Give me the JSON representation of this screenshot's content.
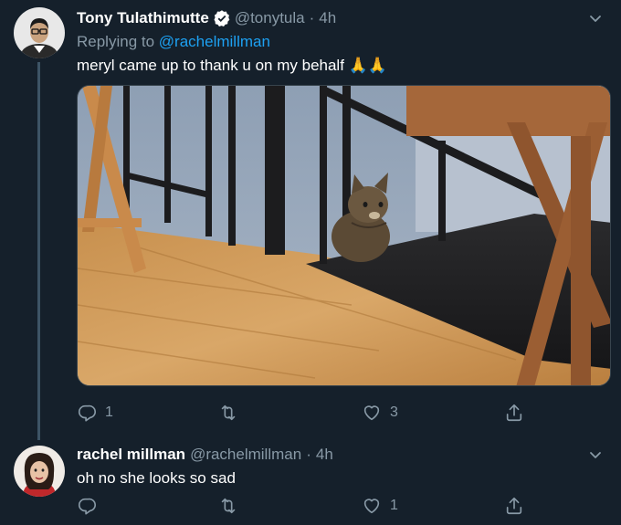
{
  "tweet_main": {
    "author_name": "Tony Tulathimutte",
    "handle": "@tonytula",
    "separator": "·",
    "time": "4h",
    "replying_prefix": "Replying to",
    "replying_handle": "@rachelmillman",
    "text": "meryl came up to thank u on my behalf 🙏🙏",
    "media_description": "photo of a tabby cat peeking over stair railing on a wooden floor",
    "reply_count": "1",
    "retweet_count": "",
    "like_count": "3"
  },
  "tweet_reply": {
    "author_name": "rachel millman",
    "handle": "@rachelmillman",
    "separator": "·",
    "time": "4h",
    "text": "oh no she looks so sad",
    "reply_count": "",
    "retweet_count": "",
    "like_count": "1"
  },
  "colors": {
    "background": "#15202b",
    "secondary_text": "#8899a6",
    "link": "#1da1f2",
    "verified": "#ffffff"
  },
  "icons": [
    "verified-badge-icon",
    "chevron-down-icon",
    "reply-icon",
    "retweet-icon",
    "like-icon",
    "share-icon"
  ]
}
